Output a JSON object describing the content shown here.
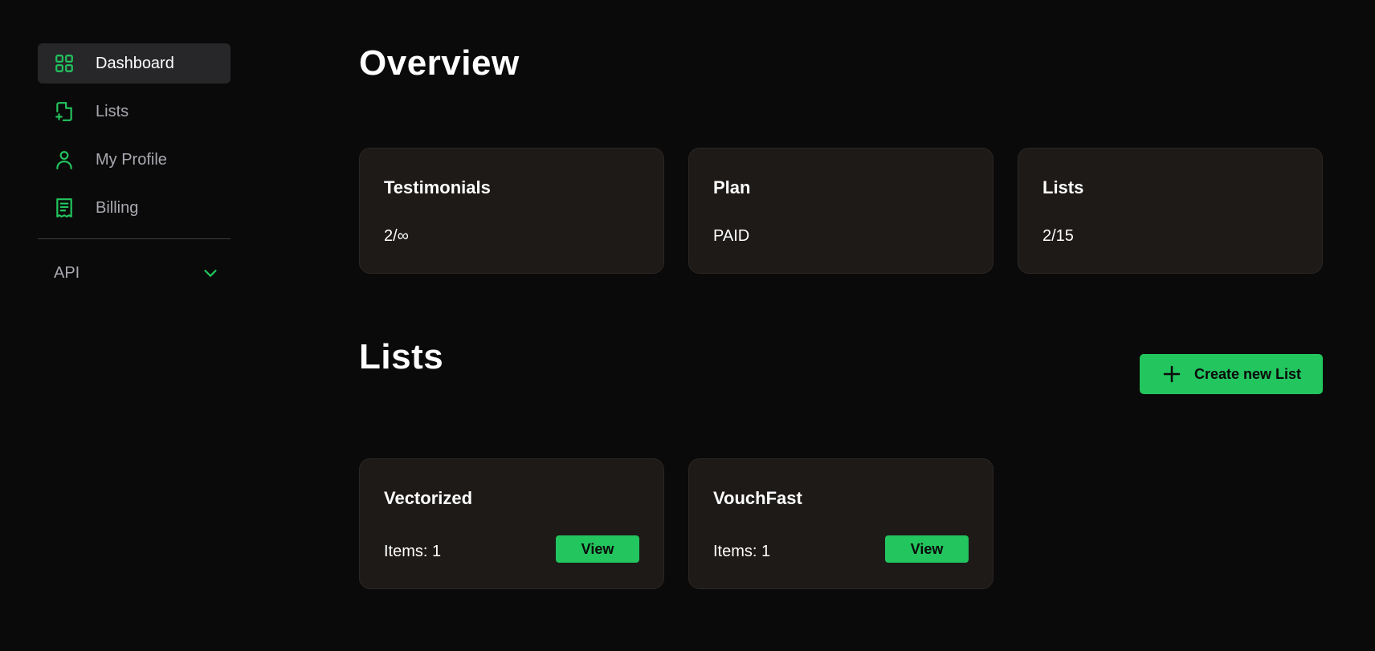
{
  "colors": {
    "accent": "#22c55e",
    "background": "#0b0a0a",
    "card": "#1d1a18",
    "nav_active_bg": "#27272a",
    "muted_text": "#a9a9b1"
  },
  "sidebar": {
    "items": [
      {
        "label": "Dashboard",
        "icon": "grid-icon",
        "active": true
      },
      {
        "label": "Lists",
        "icon": "file-plus-icon",
        "active": false
      },
      {
        "label": "My Profile",
        "icon": "user-icon",
        "active": false
      },
      {
        "label": "Billing",
        "icon": "receipt-icon",
        "active": false
      }
    ],
    "api": {
      "label": "API",
      "icon": "chevron-down-icon"
    }
  },
  "overview": {
    "title": "Overview",
    "cards": [
      {
        "title": "Testimonials",
        "value": "2/∞"
      },
      {
        "title": "Plan",
        "value": "PAID"
      },
      {
        "title": "Lists",
        "value": "2/15"
      }
    ]
  },
  "lists_section": {
    "title": "Lists",
    "create_button_label": "Create new List",
    "items": [
      {
        "name": "Vectorized",
        "items_label": "Items: 1",
        "view_label": "View"
      },
      {
        "name": "VouchFast",
        "items_label": "Items: 1",
        "view_label": "View"
      }
    ]
  }
}
